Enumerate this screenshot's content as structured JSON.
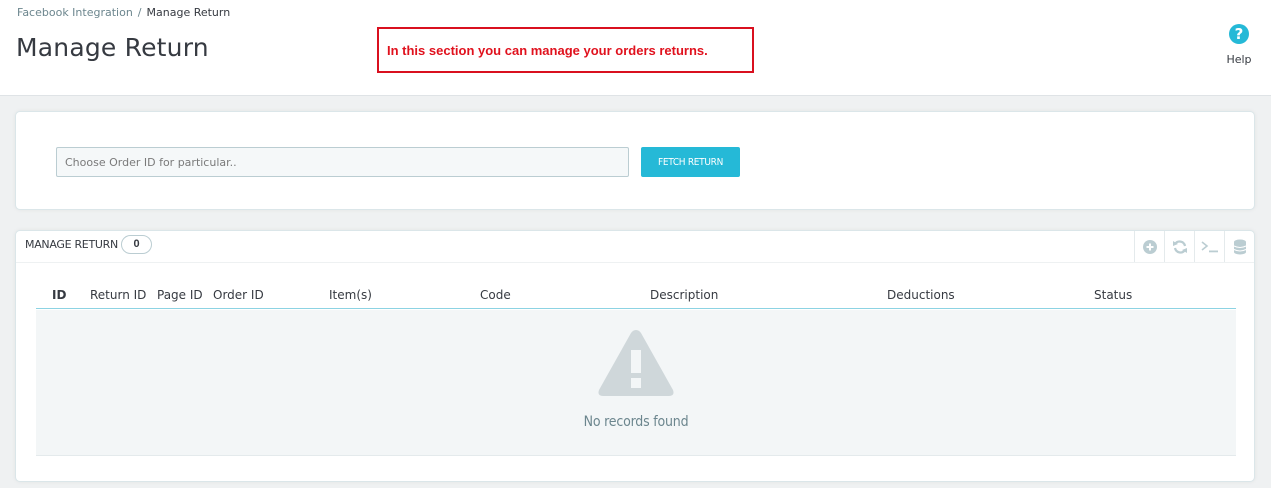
{
  "breadcrumb": {
    "parent": "Facebook Integration",
    "separator": "/",
    "current": "Manage Return"
  },
  "page_title": "Manage Return",
  "notice_text": "In this section you can manage your orders returns.",
  "help": {
    "label": "Help",
    "icon": "question-icon",
    "glyph": "?"
  },
  "fetch": {
    "input_placeholder": "Choose Order ID for particular..",
    "input_value": "",
    "button_label": "FETCH RETURN"
  },
  "list": {
    "title": "MANAGE RETURN",
    "count": "0",
    "toolbar_icons": [
      "add-new-icon",
      "refresh-icon",
      "sql-query-icon",
      "export-database-icon"
    ],
    "columns": [
      "ID",
      "Return ID",
      "Page ID",
      "Order ID",
      "Item(s)",
      "Code",
      "Description",
      "Deductions",
      "Status"
    ],
    "empty_text": "No records found"
  },
  "colors": {
    "accent": "#25b9d7",
    "notice_red": "#e0111d",
    "text": "#363a41",
    "muted": "#6c868e"
  }
}
